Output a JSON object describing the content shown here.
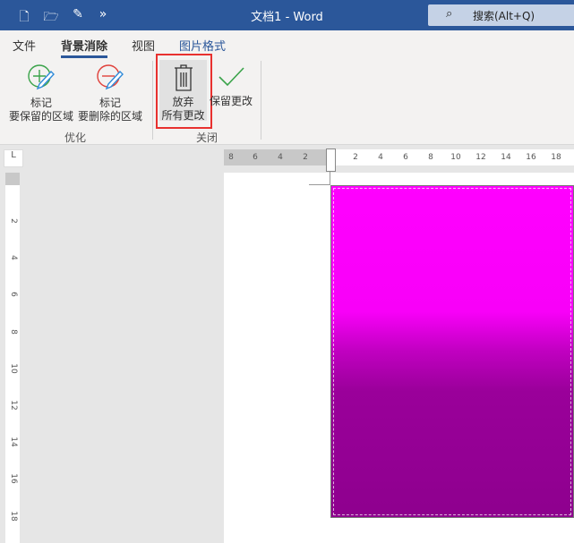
{
  "titlebar": {
    "title": "文档1 - Word",
    "search_placeholder": "搜索(Alt+Q)",
    "quick_access": [
      "new-doc-icon",
      "open-folder-icon",
      "touch-mode-icon",
      "more-icon"
    ]
  },
  "tabs": [
    {
      "label": "文件"
    },
    {
      "label": "背景消除",
      "active": true
    },
    {
      "label": "视图"
    },
    {
      "label": "图片格式",
      "color": "#2b579a"
    }
  ],
  "ribbon": {
    "refine": {
      "label": "优化",
      "mark_keep": [
        "标记",
        "要保留的区域"
      ],
      "mark_remove": [
        "标记",
        "要删除的区域"
      ]
    },
    "close": {
      "label": "关闭",
      "discard": [
        "放弃",
        "所有更改"
      ],
      "keep": "保留更改"
    }
  },
  "ruler": {
    "horizontal": [
      "8",
      "6",
      "4",
      "2",
      "2",
      "4",
      "6",
      "8",
      "10",
      "12",
      "14",
      "16",
      "18"
    ],
    "vertical": [
      "2",
      "4",
      "6",
      "8",
      "10",
      "12",
      "14",
      "16",
      "18"
    ]
  },
  "colors": {
    "accent": "#2b579a",
    "highlight": "#e8312f",
    "image_top": "#ff00ff",
    "image_bottom": "#8e008e"
  }
}
